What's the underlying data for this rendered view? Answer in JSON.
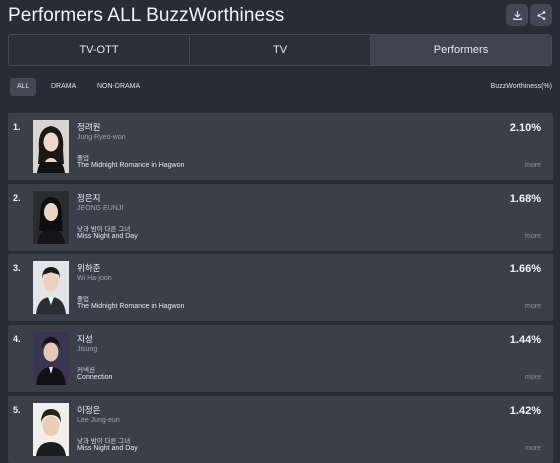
{
  "page": {
    "title": "Performers ALL BuzzWorthiness"
  },
  "icons": {
    "download": "download-icon",
    "share": "share-icon"
  },
  "tabs": [
    {
      "label": "TV-OTT",
      "active": false
    },
    {
      "label": "TV",
      "active": false
    },
    {
      "label": "Performers",
      "active": true
    }
  ],
  "filters": {
    "chips": [
      {
        "label": "ALL",
        "active": true
      },
      {
        "label": "DRAMA",
        "active": false
      },
      {
        "label": "NON-DRAMA",
        "active": false
      }
    ],
    "metric_label": "BuzzWorthiness(%)"
  },
  "performers": [
    {
      "rank": "1.",
      "name": "정려원",
      "roman": "Jung Ryeo-won",
      "show_ko": "졸업",
      "show_en": "The Midnight Romance in Hagwon",
      "score": "2.10%",
      "more": "more"
    },
    {
      "rank": "2.",
      "name": "정은지",
      "roman": "JEONG EUNJI",
      "show_ko": "낮과 밤이 다른 그녀",
      "show_en": "Miss Night and Day",
      "score": "1.68%",
      "more": "more"
    },
    {
      "rank": "3.",
      "name": "위하준",
      "roman": "Wi Ha-joon",
      "show_ko": "졸업",
      "show_en": "The Midnight Romance in Hagwon",
      "score": "1.66%",
      "more": "more"
    },
    {
      "rank": "4.",
      "name": "지성",
      "roman": "Jisung",
      "show_ko": "커넥션",
      "show_en": "Connection",
      "score": "1.44%",
      "more": "more"
    },
    {
      "rank": "5.",
      "name": "이정은",
      "roman": "Lee Jung-eun",
      "show_ko": "낮과 밤이 다른 그녀",
      "show_en": "Miss Night and Day",
      "score": "1.42%",
      "more": "more"
    }
  ]
}
